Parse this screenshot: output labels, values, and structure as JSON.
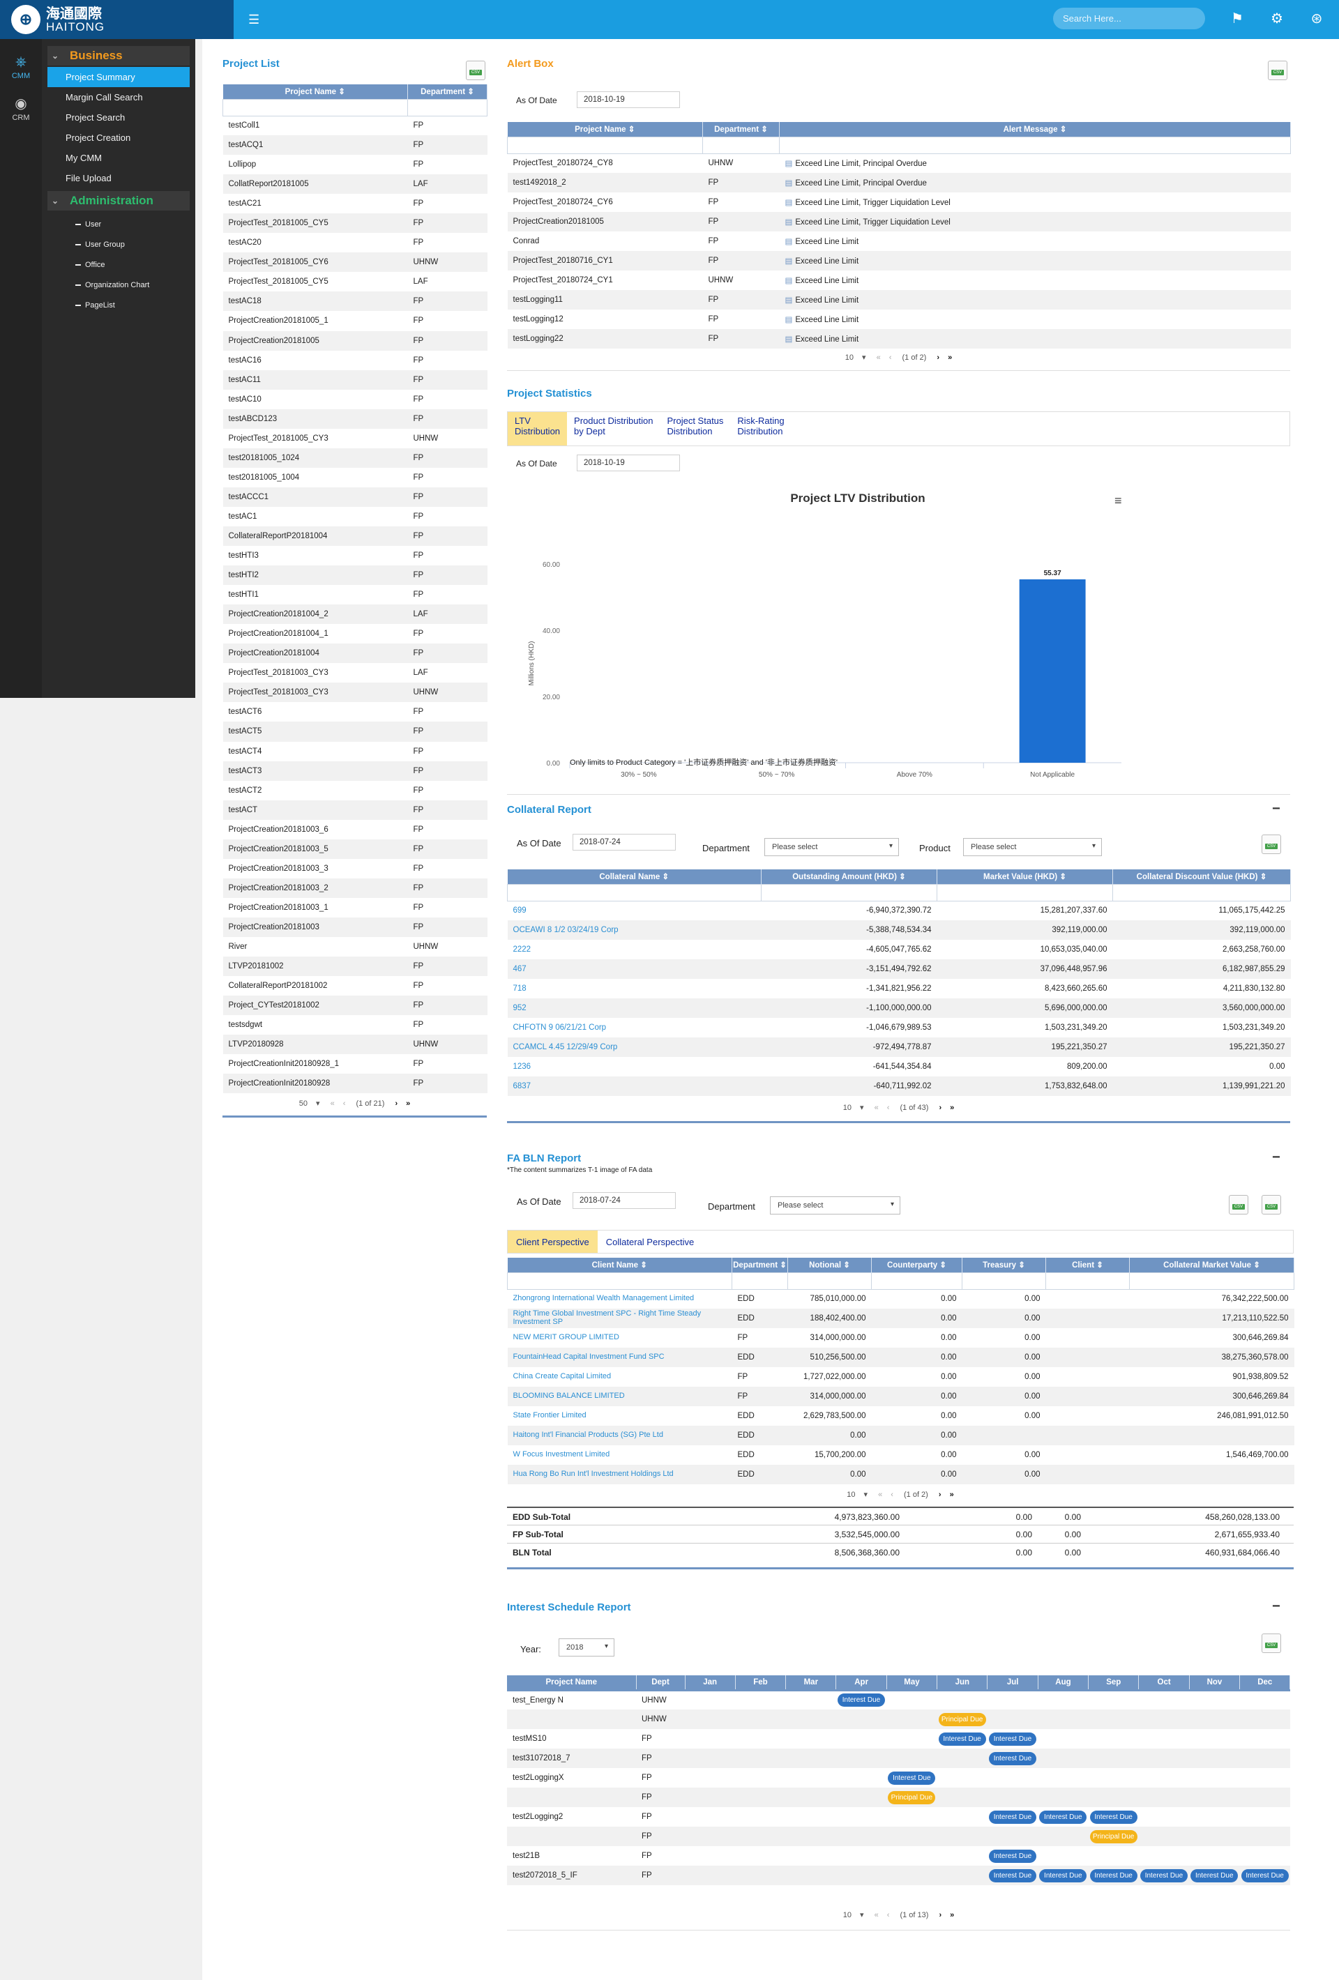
{
  "brand": {
    "name_cn": "海通國際",
    "name_en": "HAITONG"
  },
  "search": {
    "placeholder": "Search Here..."
  },
  "rail": [
    {
      "label": "CMM",
      "icon": "org-chart-icon"
    },
    {
      "label": "CRM",
      "icon": "user-circle-icon"
    }
  ],
  "menu": {
    "business_label": "Business",
    "business_items": [
      "Project Summary",
      "Margin Call Search",
      "Project Search",
      "Project Creation",
      "My CMM",
      "File Upload"
    ],
    "admin_label": "Administration",
    "admin_items": [
      "User",
      "User Group",
      "Office",
      "Organization Chart",
      "PageList"
    ]
  },
  "project_list": {
    "title": "Project List",
    "headers": [
      "Project Name",
      "Department"
    ],
    "rows": [
      [
        "testColl1",
        "FP"
      ],
      [
        "testACQ1",
        "FP"
      ],
      [
        "Lollipop",
        "FP"
      ],
      [
        "CollatReport20181005",
        "LAF"
      ],
      [
        "testAC21",
        "FP"
      ],
      [
        "ProjectTest_20181005_CY5",
        "FP"
      ],
      [
        "testAC20",
        "FP"
      ],
      [
        "ProjectTest_20181005_CY6",
        "UHNW"
      ],
      [
        "ProjectTest_20181005_CY5",
        "LAF"
      ],
      [
        "testAC18",
        "FP"
      ],
      [
        "ProjectCreation20181005_1",
        "FP"
      ],
      [
        "ProjectCreation20181005",
        "FP"
      ],
      [
        "testAC16",
        "FP"
      ],
      [
        "testAC11",
        "FP"
      ],
      [
        "testAC10",
        "FP"
      ],
      [
        "testABCD123",
        "FP"
      ],
      [
        "ProjectTest_20181005_CY3",
        "UHNW"
      ],
      [
        "test20181005_1024",
        "FP"
      ],
      [
        "test20181005_1004",
        "FP"
      ],
      [
        "testACCC1",
        "FP"
      ],
      [
        "testAC1",
        "FP"
      ],
      [
        "CollateralReportP20181004",
        "FP"
      ],
      [
        "testHTI3",
        "FP"
      ],
      [
        "testHTI2",
        "FP"
      ],
      [
        "testHTI1",
        "FP"
      ],
      [
        "ProjectCreation20181004_2",
        "LAF"
      ],
      [
        "ProjectCreation20181004_1",
        "FP"
      ],
      [
        "ProjectCreation20181004",
        "FP"
      ],
      [
        "ProjectTest_20181003_CY3",
        "LAF"
      ],
      [
        "ProjectTest_20181003_CY3",
        "UHNW"
      ],
      [
        "testACT6",
        "FP"
      ],
      [
        "testACT5",
        "FP"
      ],
      [
        "testACT4",
        "FP"
      ],
      [
        "testACT3",
        "FP"
      ],
      [
        "testACT2",
        "FP"
      ],
      [
        "testACT",
        "FP"
      ],
      [
        "ProjectCreation20181003_6",
        "FP"
      ],
      [
        "ProjectCreation20181003_5",
        "FP"
      ],
      [
        "ProjectCreation20181003_3",
        "FP"
      ],
      [
        "ProjectCreation20181003_2",
        "FP"
      ],
      [
        "ProjectCreation20181003_1",
        "FP"
      ],
      [
        "ProjectCreation20181003",
        "FP"
      ],
      [
        "River",
        "UHNW"
      ],
      [
        "LTVP20181002",
        "FP"
      ],
      [
        "CollateralReportP20181002",
        "FP"
      ],
      [
        "Project_CYTest20181002",
        "FP"
      ],
      [
        "testsdgwt",
        "FP"
      ],
      [
        "LTVP20180928",
        "UHNW"
      ],
      [
        "ProjectCreationInit20180928_1",
        "FP"
      ],
      [
        "ProjectCreationInit20180928",
        "FP"
      ]
    ],
    "pager": {
      "size": "50",
      "info": "(1 of 21)"
    }
  },
  "alert_box": {
    "title": "Alert Box",
    "as_of_label": "As Of Date",
    "as_of_value": "2018-10-19",
    "headers": [
      "Project Name",
      "Department",
      "Alert Message"
    ],
    "rows": [
      [
        "ProjectTest_20180724_CY8",
        "UHNW",
        "Exceed Line Limit, Principal Overdue"
      ],
      [
        "test1492018_2",
        "FP",
        "Exceed Line Limit, Principal Overdue"
      ],
      [
        "ProjectTest_20180724_CY6",
        "FP",
        "Exceed Line Limit, Trigger Liquidation Level"
      ],
      [
        "ProjectCreation20181005",
        "FP",
        "Exceed Line Limit, Trigger Liquidation Level"
      ],
      [
        "Conrad",
        "FP",
        "Exceed Line Limit"
      ],
      [
        "ProjectTest_20180716_CY1",
        "FP",
        "Exceed Line Limit"
      ],
      [
        "ProjectTest_20180724_CY1",
        "UHNW",
        "Exceed Line Limit"
      ],
      [
        "testLogging11",
        "FP",
        "Exceed Line Limit"
      ],
      [
        "testLogging12",
        "FP",
        "Exceed Line Limit"
      ],
      [
        "testLogging22",
        "FP",
        "Exceed Line Limit"
      ]
    ],
    "pager": {
      "size": "10",
      "info": "(1 of 2)"
    }
  },
  "project_statistics": {
    "title": "Project Statistics",
    "tabs": [
      [
        "LTV",
        "Distribution"
      ],
      [
        "Product Distribution",
        "by Dept"
      ],
      [
        "Project Status",
        "Distribution"
      ],
      [
        "Risk-Rating",
        "Distribution"
      ]
    ],
    "as_of_label": "As Of Date",
    "as_of_value": "2018-10-19",
    "footnote": "Only limits to Product Category = '上市证券质押融资' and '非上市证券质押融资'"
  },
  "chart_data": {
    "type": "bar",
    "title": "Project LTV Distribution",
    "ylabel": "Millions (HKD)",
    "xlabel": "",
    "categories": [
      "30% ~ 50%",
      "50% ~ 70%",
      "Above 70%",
      "Not Applicable"
    ],
    "values": [
      0,
      0,
      0,
      55.37
    ],
    "data_labels": [
      "",
      "",
      "",
      "55.37"
    ],
    "y_ticks": [
      "0.00",
      "20.00",
      "40.00",
      "60.00"
    ],
    "ylim": [
      0,
      60
    ],
    "grid": false,
    "legend": "none",
    "bar_color": "#1c6fd1"
  },
  "collateral": {
    "title": "Collateral Report",
    "as_of_label": "As Of Date",
    "as_of_value": "2018-07-24",
    "department_label": "Department",
    "department_value": "Please select",
    "product_label": "Product",
    "product_value": "Please select",
    "headers": [
      "Collateral Name",
      "Outstanding Amount (HKD)",
      "Market Value (HKD)",
      "Collateral Discount Value (HKD)"
    ],
    "rows": [
      [
        "699",
        "-6,940,372,390.72",
        "15,281,207,337.60",
        "11,065,175,442.25"
      ],
      [
        "OCEAWI 8 1/2 03/24/19 Corp",
        "-5,388,748,534.34",
        "392,119,000.00",
        "392,119,000.00"
      ],
      [
        "2222",
        "-4,605,047,765.62",
        "10,653,035,040.00",
        "2,663,258,760.00"
      ],
      [
        "467",
        "-3,151,494,792.62",
        "37,096,448,957.96",
        "6,182,987,855.29"
      ],
      [
        "718",
        "-1,341,821,956.22",
        "8,423,660,265.60",
        "4,211,830,132.80"
      ],
      [
        "952",
        "-1,100,000,000.00",
        "5,696,000,000.00",
        "3,560,000,000.00"
      ],
      [
        "CHFOTN 9 06/21/21 Corp",
        "-1,046,679,989.53",
        "1,503,231,349.20",
        "1,503,231,349.20"
      ],
      [
        "CCAMCL 4.45 12/29/49 Corp",
        "-972,494,778.87",
        "195,221,350.27",
        "195,221,350.27"
      ],
      [
        "1236",
        "-641,544,354.84",
        "809,200.00",
        "0.00"
      ],
      [
        "6837",
        "-640,711,992.02",
        "1,753,832,648.00",
        "1,139,991,221.20"
      ]
    ],
    "pager": {
      "size": "10",
      "info": "(1 of 43)"
    }
  },
  "fa_bln": {
    "title": "FA BLN Report",
    "note": "*The content summarizes T-1 image of FA data",
    "as_of_label": "As Of Date",
    "as_of_value": "2018-07-24",
    "department_label": "Department",
    "department_value": "Please select",
    "tabs": [
      "Client Perspective",
      "Collateral Perspective"
    ],
    "headers": [
      "Client Name",
      "Department",
      "Notional",
      "Counterparty",
      "Treasury",
      "Client",
      "Collateral Market Value"
    ],
    "rows": [
      [
        "Zhongrong International Wealth Management Limited",
        "EDD",
        "785,010,000.00",
        "0.00",
        "0.00",
        "",
        "76,342,222,500.00"
      ],
      [
        "Right Time Global Investment SPC - Right Time Steady Investment SP",
        "EDD",
        "188,402,400.00",
        "0.00",
        "0.00",
        "",
        "17,213,110,522.50"
      ],
      [
        "NEW MERIT GROUP LIMITED",
        "FP",
        "314,000,000.00",
        "0.00",
        "0.00",
        "",
        "300,646,269.84"
      ],
      [
        "FountainHead Capital Investment Fund SPC",
        "EDD",
        "510,256,500.00",
        "0.00",
        "0.00",
        "",
        "38,275,360,578.00"
      ],
      [
        "China Create Capital Limited",
        "FP",
        "1,727,022,000.00",
        "0.00",
        "0.00",
        "",
        "901,938,809.52"
      ],
      [
        "BLOOMING BALANCE LIMITED",
        "FP",
        "314,000,000.00",
        "0.00",
        "0.00",
        "",
        "300,646,269.84"
      ],
      [
        "State Frontier Limited",
        "EDD",
        "2,629,783,500.00",
        "0.00",
        "0.00",
        "",
        "246,081,991,012.50"
      ],
      [
        "Haitong Int'l Financial Products (SG) Pte Ltd",
        "EDD",
        "0.00",
        "0.00",
        "",
        "",
        ""
      ],
      [
        "W Focus Investment Limited",
        "EDD",
        "15,700,200.00",
        "0.00",
        "0.00",
        "",
        "1,546,469,700.00"
      ],
      [
        "Hua Rong Bo Run Int'l Investment Holdings Ltd",
        "EDD",
        "0.00",
        "0.00",
        "0.00",
        "",
        ""
      ]
    ],
    "pager": {
      "size": "10",
      "info": "(1 of 2)"
    },
    "totals": [
      [
        "EDD Sub-Total",
        "4,973,823,360.00",
        "0.00",
        "0.00",
        "458,260,028,133.00"
      ],
      [
        "FP Sub-Total",
        "3,532,545,000.00",
        "0.00",
        "0.00",
        "2,671,655,933.40"
      ],
      [
        "BLN Total",
        "8,506,368,360.00",
        "0.00",
        "0.00",
        "460,931,684,066.40"
      ]
    ]
  },
  "interest": {
    "title": "Interest Schedule Report",
    "year_label": "Year:",
    "year_value": "2018",
    "headers": [
      "Project Name",
      "Dept",
      "Jan",
      "Feb",
      "Mar",
      "Apr",
      "May",
      "Jun",
      "Jul",
      "Aug",
      "Sep",
      "Oct",
      "Nov",
      "Dec"
    ],
    "rows": [
      {
        "name": "test_Energy N",
        "dept": "UHNW",
        "events": [
          [
            "Apr",
            "Interest Due"
          ]
        ]
      },
      {
        "name": "",
        "dept": "UHNW",
        "events": [
          [
            "Jun",
            "Principal Due"
          ]
        ]
      },
      {
        "name": "testMS10",
        "dept": "FP",
        "events": [
          [
            "Jun",
            "Interest Due"
          ],
          [
            "Jul",
            "Interest Due"
          ]
        ]
      },
      {
        "name": "test31072018_7",
        "dept": "FP",
        "events": [
          [
            "Jul",
            "Interest Due"
          ]
        ]
      },
      {
        "name": "test2LoggingX",
        "dept": "FP",
        "events": [
          [
            "May",
            "Interest Due"
          ]
        ]
      },
      {
        "name": "",
        "dept": "FP",
        "events": [
          [
            "May",
            "Principal Due"
          ]
        ]
      },
      {
        "name": "test2Logging2",
        "dept": "FP",
        "events": [
          [
            "Jul",
            "Interest Due"
          ],
          [
            "Aug",
            "Interest Due"
          ],
          [
            "Sep",
            "Interest Due"
          ]
        ]
      },
      {
        "name": "",
        "dept": "FP",
        "events": [
          [
            "Sep",
            "Principal Due"
          ]
        ]
      },
      {
        "name": "test21B",
        "dept": "FP",
        "events": [
          [
            "Jul",
            "Interest Due"
          ]
        ]
      },
      {
        "name": "test2072018_5_IF",
        "dept": "FP",
        "events": [
          [
            "Jul",
            "Interest Due"
          ],
          [
            "Aug",
            "Interest Due"
          ],
          [
            "Sep",
            "Interest Due"
          ],
          [
            "Oct",
            "Interest Due"
          ],
          [
            "Nov",
            "Interest Due"
          ],
          [
            "Dec",
            "Interest Due"
          ]
        ]
      }
    ],
    "pager": {
      "size": "10",
      "info": "(1 of 13)"
    }
  },
  "icons": {
    "csv": "CSV",
    "first": "«",
    "prev": "‹",
    "next": "›",
    "last": "»",
    "dropdown": "▾",
    "collapse": "−",
    "sort": "⇕"
  }
}
